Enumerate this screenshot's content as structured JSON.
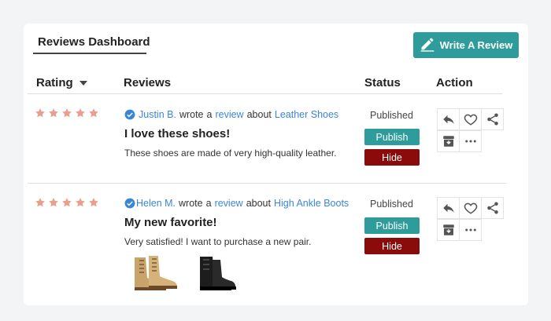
{
  "header": {
    "title": "Reviews Dashboard",
    "write_button_label": "Write A Review"
  },
  "columns": {
    "rating": "Rating",
    "reviews": "Reviews",
    "status": "Status",
    "action": "Action"
  },
  "colors": {
    "accent": "#2e9c9a",
    "danger": "#8b0a0a",
    "link": "#3a86d6",
    "star": "#e8a08e"
  },
  "reviews": [
    {
      "rating": 5,
      "author": "Justin B.",
      "wrote": "wrote",
      "a": "a",
      "review_word": "review",
      "about": "about",
      "product": "Leather Shoes",
      "title": "I love these shoes!",
      "body": "These shoes are made of very high-quality leather.",
      "status": "Published",
      "publish_label": "Publish",
      "hide_label": "Hide",
      "has_images": false
    },
    {
      "rating": 5,
      "author": "Helen M.",
      "wrote": "wrote",
      "a": "a",
      "review_word": "review",
      "about": "about",
      "product": "High Ankle Boots",
      "title": "My new favorite!",
      "body": "Very satisfied! I want to purchase a new pair.",
      "status": "Published",
      "publish_label": "Publish",
      "hide_label": "Hide",
      "has_images": true,
      "images": [
        "tan-boot-image",
        "black-boot-image"
      ]
    }
  ]
}
